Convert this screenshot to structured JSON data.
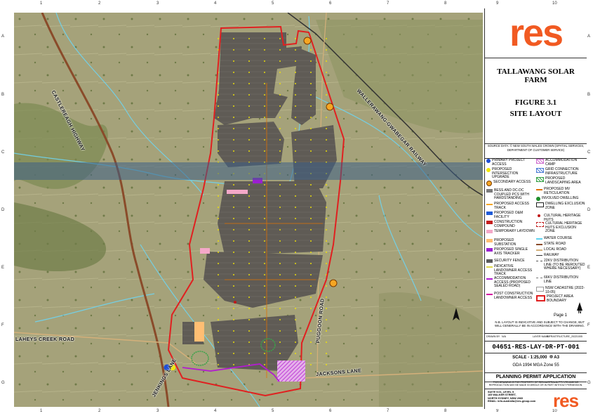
{
  "project": {
    "name": "TALLAWANG SOLAR FARM",
    "figure": "FIGURE 3.1",
    "subtitle": "SITE LAYOUT"
  },
  "logo": {
    "text": "res",
    "footer_text": "res",
    "color": "#f15a22"
  },
  "source_note": "SOURCE DATA: © NEW SOUTH WALES CROWN (SPATIAL SERVICES, DEPARTMENT OF CUSTOMER SERVICE)",
  "grid": {
    "columns": [
      "1",
      "2",
      "3",
      "4",
      "5",
      "6",
      "7",
      "8",
      "9",
      "10"
    ],
    "rows": [
      "A",
      "B",
      "C",
      "D",
      "E",
      "F",
      "G"
    ]
  },
  "map_labels": {
    "castlereagh_highway": "CASTLEREAGH HIGHWAY",
    "wallerawang_road": "WALLERAWANG-GWABEGAR RAILWAY",
    "laheys_creek": "LAHEYS CREEK ROAD",
    "puggoon_road": "PUGGOON ROAD",
    "jenkings_lane": "JENKINGS LANE",
    "jacksons_lane": "JACKSONS LANE"
  },
  "legend": {
    "left": [
      {
        "label": "PRIMARY PROJECT ACCESS",
        "icon": "blue-dot",
        "color": "#1f4fd6"
      },
      {
        "label": "PROPOSED INTERSECTION UPGRADE",
        "icon": "yellow-dot",
        "color": "#f2e600"
      },
      {
        "label": "SECONDARY ACCESS",
        "icon": "x-circle",
        "color": "#e08a00"
      },
      {
        "label": "BESS AND DC-DC COUPLED PCS WITH HARDSTANDING",
        "icon": "grey-square",
        "color": "#7a7a7a"
      },
      {
        "label": "PROPOSED ACCESS TRACK",
        "icon": "orange-line",
        "color": "#f5a623"
      },
      {
        "label": "PROPOSED O&M FACILITY",
        "icon": "blue-square",
        "color": "#1e5bd7"
      },
      {
        "label": "CONSTRUCTION COMPOUND",
        "icon": "red-square",
        "color": "#c41e1e"
      },
      {
        "label": "TEMPORARY LAYDOWN",
        "icon": "pink-square",
        "color": "#f4a8c8"
      },
      {
        "label": "PROPOSED SUBSTATION",
        "icon": "orange-square",
        "color": "#ffbe73"
      },
      {
        "label": "PROPOSED SINGLE AXIS TRACKER",
        "icon": "purple-square",
        "color": "#9b1fd0"
      },
      {
        "label": "SECURITY FENCE",
        "icon": "grey-square",
        "color": "#5a5a5a"
      },
      {
        "label": "INDICATIVE LANDOWNER ACCESS TRACK",
        "icon": "yellow-line",
        "color": "#e0d84a"
      },
      {
        "label": "ACCOMMODATION ACCESS (PROPOSED SEALED ROAD)",
        "icon": "purple-line",
        "color": "#b21bd0"
      },
      {
        "label": "POST CONSTRUCTION LANDOWNER ACCESS",
        "icon": "magenta-line",
        "color": "#d400a0"
      }
    ],
    "right": [
      {
        "label": "ACCOMMODATION CAMP",
        "icon": "pink-hatch",
        "color": "#d070d0"
      },
      {
        "label": "GRID CONNECTION INFRASTRUCTURE",
        "icon": "blue-hatch",
        "color": "#4f7fd6"
      },
      {
        "label": "PROPOSED LANDSCAPING AREA",
        "icon": "green-hatch",
        "color": "#3aa34a"
      },
      {
        "label": "PROPOSED MV RETICULATION",
        "icon": "orange-dash",
        "color": "#e07000"
      },
      {
        "label": "INVOLVED DWELLING",
        "icon": "green-dot",
        "color": "#1e8f2a"
      },
      {
        "label": "DWELLING EXCLUSION ZONE",
        "icon": "black-square",
        "color": "#222222"
      },
      {
        "label": "CULTURAL HERITAGE HUTS",
        "icon": "red-dot",
        "color": "#c01818"
      },
      {
        "label": "CULTURAL HERITAGE HUTS EXCLUSION ZONE",
        "icon": "red-outline",
        "color": "#c01818"
      },
      {
        "label": "WATER COURSE",
        "icon": "cyan-line",
        "color": "#5fd3f0"
      },
      {
        "label": "STATE ROAD",
        "icon": "brown-line",
        "color": "#8a4b2a"
      },
      {
        "label": "LOCAL ROAD",
        "icon": "tan-line",
        "color": "#d4b07a"
      },
      {
        "label": "RAILWAY",
        "icon": "rail-line",
        "color": "#333333"
      },
      {
        "label": "22KV DISTRIBUTION LINE (TO BE REROUTED WHERE NECESSARY)",
        "icon": "dash-line",
        "color": "#555555"
      },
      {
        "label": "66KV DISTRIBUTION LINE",
        "icon": "dash-line",
        "color": "#777777"
      },
      {
        "label": "NSW CADASTRE (2022-10-05)",
        "icon": "grey-outline",
        "color": "#9a9a9a"
      },
      {
        "label": "PROJECT AREA BOUNDARY",
        "icon": "red-box",
        "color": "#e02020"
      }
    ]
  },
  "page_label": "Page 1",
  "north_label": "N",
  "notes": "N.B. LAYOUT IS INDICATIVE AND SUBJECT TO CHANGE, BUT WILL GENERALLY BE IN ACCORDANCE WITH THE DRAWING.",
  "meta": {
    "drawn_label": "DRAWN BY",
    "drawn_value": "N/A",
    "layer_label": "LAYER NAME",
    "layer_value": "INFRASTRUCTURE_20221005"
  },
  "drawing_number": "04651-RES-LAY-DR-PT-001",
  "scale": "SCALE - 1:25,000",
  "paper": "A3",
  "crs": "GDA 1994 MGA Zone 55",
  "status": "PLANNING PERMIT APPLICATION",
  "disclaimer": "THIS DRAWING IS THE PROPERTY OF RES AUSTRALIA PTY LTD AND NO REPRODUCTION MAY BE MADE IN WHOLE OR IN PART WITHOUT PERMISSION.",
  "address": [
    "SUITE 5.01, LEVEL 5",
    "165 WALKER STREET,",
    "NORTH SYDNEY, NSW 2060",
    "",
    "EMAIL: info-australia@res-group.com"
  ],
  "colors": {
    "boundary": "#e02020",
    "panels": "#5e5a54",
    "water": "#6fd4ef",
    "state_road": "#8a4b2a"
  }
}
